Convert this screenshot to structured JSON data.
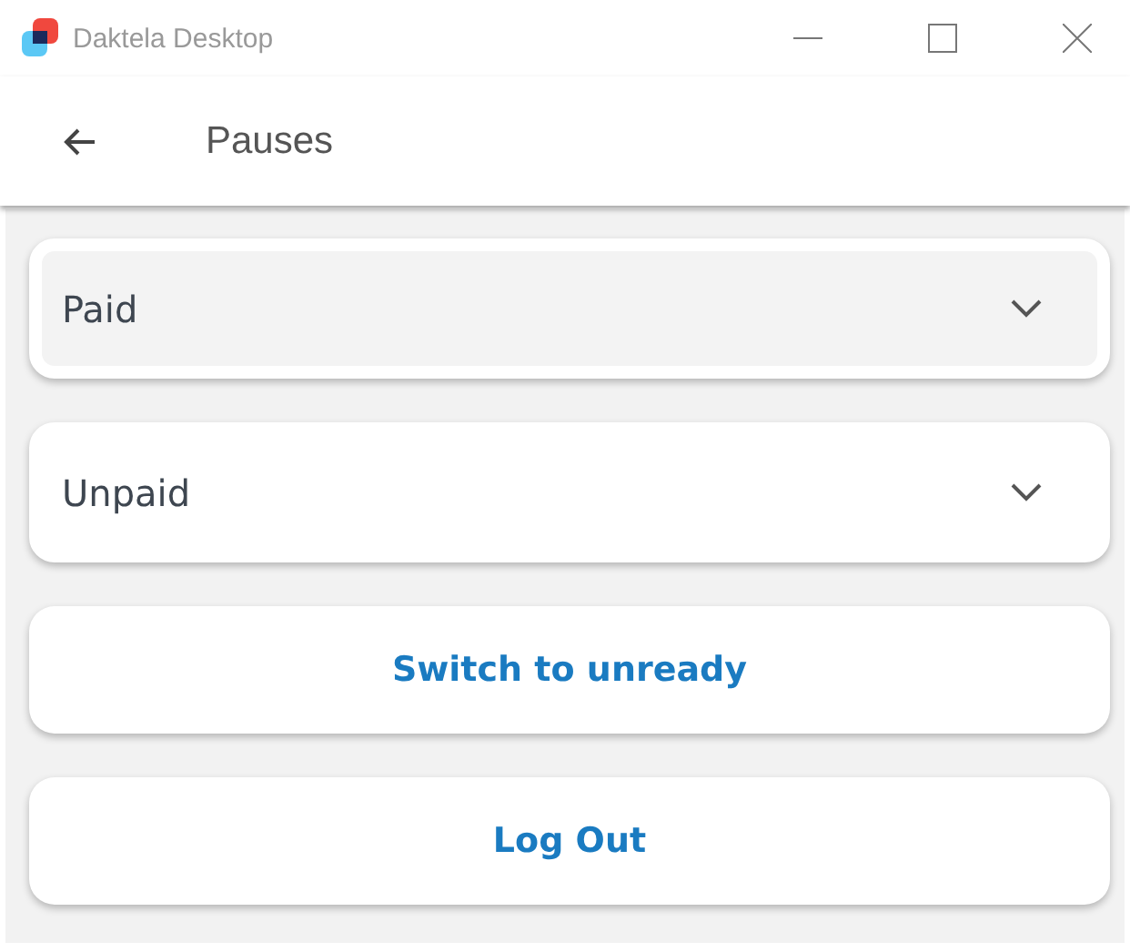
{
  "window": {
    "title": "Daktela Desktop"
  },
  "header": {
    "title": "Pauses"
  },
  "groups": [
    {
      "label": "Paid",
      "selected": true,
      "expanded": false
    },
    {
      "label": "Unpaid",
      "selected": false,
      "expanded": false
    }
  ],
  "buttons": [
    "Switch to unready",
    "Log Out"
  ]
}
